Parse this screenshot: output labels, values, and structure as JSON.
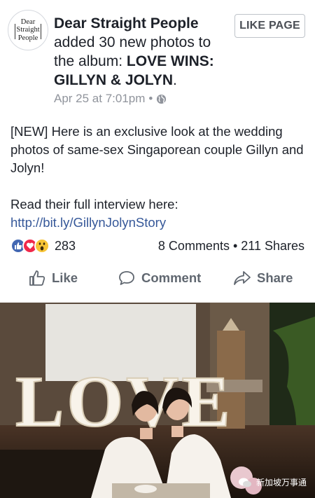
{
  "page": {
    "avatar_lines": [
      "Dear",
      "Straight",
      "People"
    ],
    "name": "Dear Straight People",
    "action_text": " added 30 new photos to the album: ",
    "album_title": "LOVE WINS: GILLYN & JOLYN",
    "album_suffix": ".",
    "timestamp": "Apr 25 at 7:01pm",
    "meta_separator": "•",
    "privacy_icon": "globe-icon"
  },
  "header": {
    "like_page_label": "LIKE PAGE"
  },
  "post": {
    "paragraph1": "[NEW] Here is an exclusive look at the wedding photos of same-sex Singaporean couple Gillyn and Jolyn!",
    "paragraph2_text": "Read their full interview here: ",
    "paragraph2_link": "http://bit.ly/GillynJolynStory"
  },
  "stats": {
    "reaction_icons": [
      "like-reaction-icon",
      "love-reaction-icon",
      "wow-reaction-icon"
    ],
    "reaction_count": "283",
    "comments_shares": "8 Comments • 211 Shares"
  },
  "actions": {
    "like_label": "Like",
    "comment_label": "Comment",
    "share_label": "Share"
  },
  "photo": {
    "sign_text": "LOVE",
    "watermark": "新加坡万事通"
  },
  "colors": {
    "text": "#1d2129",
    "secondary": "#90949c",
    "link": "#365899",
    "action": "#606770",
    "like_blue": "#4267b2",
    "love_red": "#f0284a",
    "wow_yellow": "#f7c436"
  }
}
